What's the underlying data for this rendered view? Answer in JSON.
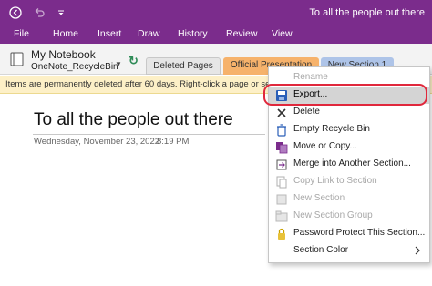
{
  "window": {
    "title": "To all the people out there"
  },
  "ribbon": {
    "tabs": [
      "File",
      "Home",
      "Insert",
      "Draw",
      "History",
      "Review",
      "View"
    ]
  },
  "notebook": {
    "name": "My Notebook",
    "section": "OneNote_RecycleBin",
    "section_tabs": [
      "Deleted Pages",
      "Official Presentation",
      "New Section 1"
    ]
  },
  "banner": {
    "text": "Items are permanently deleted after 60 days. Right-click a page or section"
  },
  "page": {
    "title": "To all the people out there",
    "date": "Wednesday, November 23, 2022",
    "time": "8:19 PM"
  },
  "context_menu": {
    "items": [
      {
        "label": "Rename",
        "icon": "rename-icon",
        "enabled": false
      },
      {
        "label": "Export...",
        "icon": "export-icon",
        "enabled": true,
        "highlighted": true
      },
      {
        "label": "Delete",
        "icon": "delete-x-icon",
        "enabled": true
      },
      {
        "label": "Empty Recycle Bin",
        "icon": "recycle-bin-icon",
        "enabled": true
      },
      {
        "label": "Move or Copy...",
        "icon": "move-copy-icon",
        "enabled": true
      },
      {
        "label": "Merge into Another Section...",
        "icon": "merge-icon",
        "enabled": true
      },
      {
        "label": "Copy Link to Section",
        "icon": "copy-link-icon",
        "enabled": false
      },
      {
        "label": "New Section",
        "icon": "new-section-icon",
        "enabled": false
      },
      {
        "label": "New Section Group",
        "icon": "new-section-group-icon",
        "enabled": false
      },
      {
        "label": "Password Protect This Section...",
        "icon": "lock-icon",
        "enabled": true
      },
      {
        "label": "Section Color",
        "icon": "",
        "enabled": true,
        "submenu": true
      }
    ]
  },
  "colors": {
    "title_bar": "#7b2c8c",
    "official_tab": "#f6b26b",
    "new_section_tab": "#aec4e8",
    "banner": "#fdf0c7",
    "highlight_ring": "#e0283c"
  }
}
